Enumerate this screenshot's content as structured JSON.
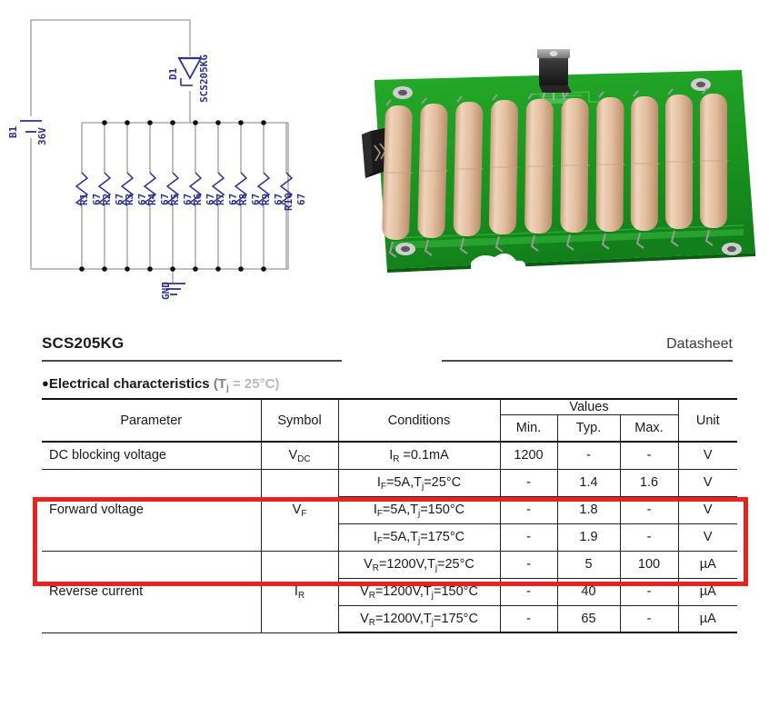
{
  "schematic": {
    "name": "resistor-load-bank-schematic",
    "battery": {
      "ref": "B1",
      "value": "36V"
    },
    "diode": {
      "ref": "D1",
      "part": "SCS205KG"
    },
    "ground": {
      "label": "GND"
    },
    "resistors": [
      {
        "ref": "R1",
        "value": "67"
      },
      {
        "ref": "R2",
        "value": "67"
      },
      {
        "ref": "R3",
        "value": "67"
      },
      {
        "ref": "R4",
        "value": "67"
      },
      {
        "ref": "R5",
        "value": "67"
      },
      {
        "ref": "R6",
        "value": "67"
      },
      {
        "ref": "R7",
        "value": "67"
      },
      {
        "ref": "R8",
        "value": "67"
      },
      {
        "ref": "R9",
        "value": "67"
      },
      {
        "ref": "R10",
        "value": "67"
      }
    ],
    "wire_color": "#9a9a9a",
    "symbol_color": "#2e3192"
  },
  "pcb": {
    "name": "resistor-bank-pcb-3d-render",
    "board_color": "#1f9b24",
    "resistor_color": "#e3bfa0",
    "resistor_count": 10,
    "components": [
      "TO-220 package",
      "2-pin connector",
      "4 mounting holes"
    ]
  },
  "datasheet": {
    "part_number": "SCS205KG",
    "doc_label": "Datasheet",
    "section_bullet": "●",
    "section_title": "Electrical characteristics",
    "section_cond_open": "(T",
    "section_cond_sub": "j",
    "section_cond_rest": " = 25°C)",
    "highlight_color": "#e8231e",
    "table": {
      "headers": {
        "parameter": "Parameter",
        "symbol": "Symbol",
        "conditions": "Conditions",
        "values": "Values",
        "min": "Min.",
        "typ": "Typ.",
        "max": "Max.",
        "unit": "Unit"
      },
      "rows": [
        {
          "parameter": "DC blocking voltage",
          "symbol_main": "V",
          "symbol_sub": "DC",
          "highlighted": false,
          "lines": [
            {
              "cond_pre": "I",
              "cond_sub": "R",
              "cond_post": " =0.1mA",
              "min": "1200",
              "typ": "-",
              "max": "-",
              "unit": "V"
            }
          ]
        },
        {
          "parameter": "Forward voltage",
          "symbol_main": "V",
          "symbol_sub": "F",
          "highlighted": true,
          "lines": [
            {
              "cond_pre": "I",
              "cond_sub": "F",
              "cond_post": "=5A,T",
              "cond_sub2": "j",
              "cond_post2": "=25°C",
              "min": "-",
              "typ": "1.4",
              "max": "1.6",
              "unit": "V"
            },
            {
              "cond_pre": "I",
              "cond_sub": "F",
              "cond_post": "=5A,T",
              "cond_sub2": "j",
              "cond_post2": "=150°C",
              "min": "-",
              "typ": "1.8",
              "max": "-",
              "unit": "V"
            },
            {
              "cond_pre": "I",
              "cond_sub": "F",
              "cond_post": "=5A,T",
              "cond_sub2": "j",
              "cond_post2": "=175°C",
              "min": "-",
              "typ": "1.9",
              "max": "-",
              "unit": "V"
            }
          ]
        },
        {
          "parameter": "Reverse current",
          "symbol_main": "I",
          "symbol_sub": "R",
          "highlighted": false,
          "lines": [
            {
              "cond_pre": "V",
              "cond_sub": "R",
              "cond_post": "=1200V,T",
              "cond_sub2": "j",
              "cond_post2": "=25°C",
              "min": "-",
              "typ": "5",
              "max": "100",
              "unit": "µA"
            },
            {
              "cond_pre": "V",
              "cond_sub": "R",
              "cond_post": "=1200V,T",
              "cond_sub2": "j",
              "cond_post2": "=150°C",
              "min": "-",
              "typ": "40",
              "max": "-",
              "unit": "µA"
            },
            {
              "cond_pre": "V",
              "cond_sub": "R",
              "cond_post": "=1200V,T",
              "cond_sub2": "j",
              "cond_post2": "=175°C",
              "min": "-",
              "typ": "65",
              "max": "-",
              "unit": "µA"
            }
          ]
        }
      ]
    }
  }
}
